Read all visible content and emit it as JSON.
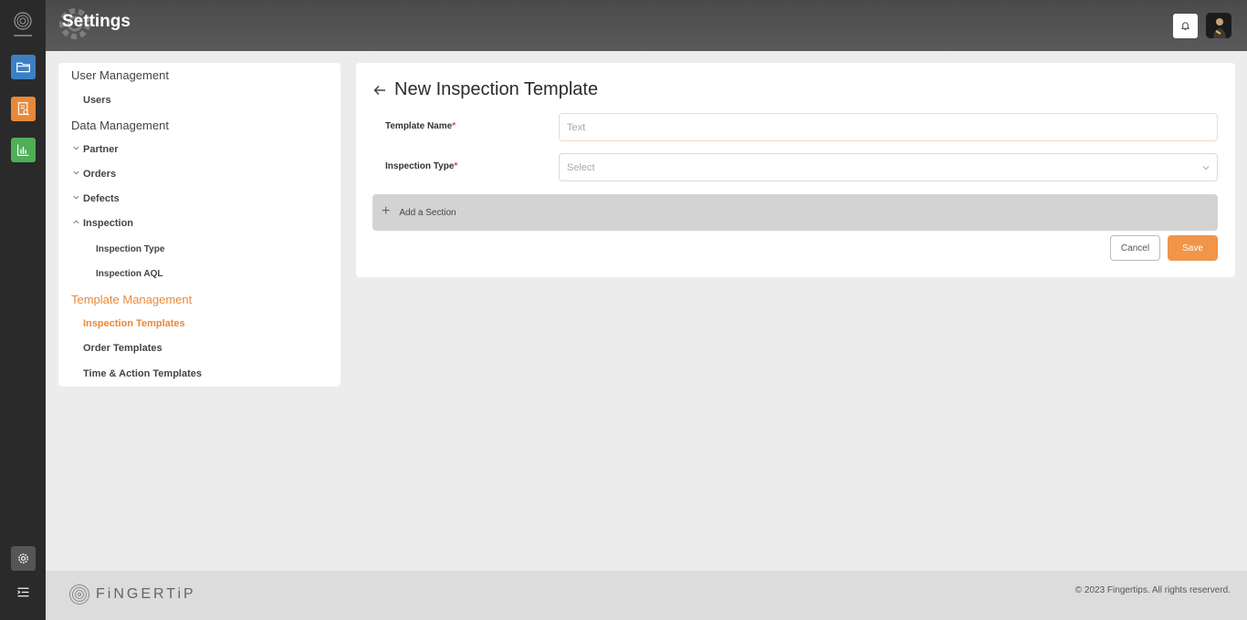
{
  "header": {
    "title": "Settings"
  },
  "rail": {
    "logo_text": "FINGERTIP",
    "items": [
      {
        "icon": "folder-icon",
        "color": "#3d7fc4"
      },
      {
        "icon": "report-search-icon",
        "color": "#e8893a"
      },
      {
        "icon": "bar-chart-icon",
        "color": "#4fae58"
      },
      {
        "icon": "gear-icon",
        "color": "#555555"
      },
      {
        "icon": "menu-icon"
      }
    ]
  },
  "menu": {
    "user_management": "User Management",
    "users": "Users",
    "data_management": "Data Management",
    "partner": "Partner",
    "orders": "Orders",
    "defects": "Defects",
    "inspection": "Inspection",
    "inspection_type": "Inspection Type",
    "inspection_aql": "Inspection AQL",
    "template_management": "Template Management",
    "inspection_templates": "Inspection Templates",
    "order_templates": "Order Templates",
    "time_action_templates": "Time & Action Templates"
  },
  "form": {
    "title": "New Inspection Template",
    "template_name_label": "Template Name",
    "template_name_placeholder": "Text",
    "template_name_value": "",
    "inspection_type_label": "Inspection Type",
    "inspection_type_placeholder": "Select",
    "required_mark": "*",
    "add_section": "Add a Section",
    "cancel": "Cancel",
    "save": "Save"
  },
  "footer": {
    "brand": "FiNGERTiP",
    "copyright": "© 2023 Fingertips. All rights reserverd."
  },
  "colors": {
    "accent": "#e8893a",
    "save": "#f0954a",
    "rail": "#2a2a2a"
  }
}
